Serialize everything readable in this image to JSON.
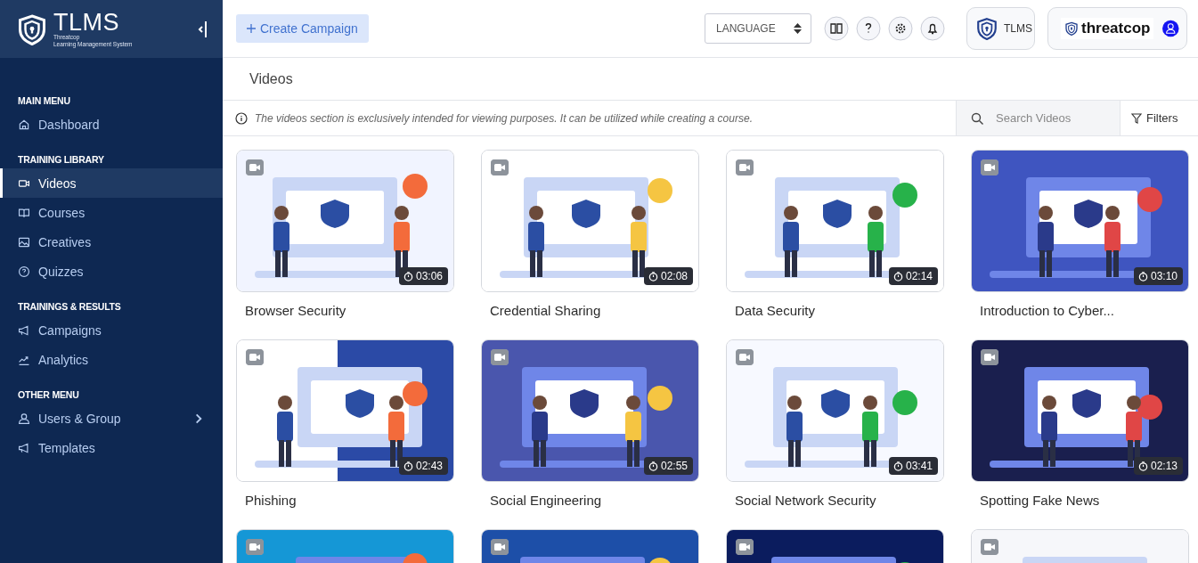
{
  "brand": {
    "name": "TLMS",
    "company": "Threatcop",
    "subtitle": "Learning Management System"
  },
  "sidebar": {
    "sections": [
      {
        "heading": "MAIN MENU",
        "items": [
          {
            "label": "Dashboard",
            "kind": "link",
            "selected": false
          }
        ]
      },
      {
        "heading": "TRAINING LIBRARY",
        "items": [
          {
            "label": "Videos",
            "kind": "link",
            "selected": true
          },
          {
            "label": "Courses",
            "kind": "link",
            "selected": false
          },
          {
            "label": "Creatives",
            "kind": "link",
            "selected": false
          },
          {
            "label": "Quizzes",
            "kind": "link",
            "selected": false
          }
        ]
      },
      {
        "heading": "TRAININGS & RESULTS",
        "items": [
          {
            "label": "Campaigns",
            "kind": "link",
            "selected": false
          },
          {
            "label": "Analytics",
            "kind": "link",
            "selected": false
          }
        ]
      },
      {
        "heading": "OTHER MENU",
        "items": [
          {
            "label": "Users & Group",
            "kind": "group",
            "selected": false
          },
          {
            "label": "Templates",
            "kind": "link",
            "selected": false
          }
        ]
      }
    ]
  },
  "header": {
    "create_button": "Create Campaign",
    "language": "LANGUAGE",
    "product_logo": "TLMS",
    "company_logo": "threatcop"
  },
  "page": {
    "title": "Videos",
    "notice": "The videos section is exclusively intended for viewing purposes. It can be utilized while creating a course.",
    "search": {
      "placeholder": "Search Videos"
    },
    "filters": "Filters"
  },
  "videos": [
    {
      "thumbnail": {
        "kind": "picture"
      },
      "duration": "03:06",
      "title": "Browser Security"
    },
    {
      "thumbnail": {
        "kind": "picture"
      },
      "duration": "02:08",
      "title": "Credential Sharing"
    },
    {
      "thumbnail": {
        "kind": "picture"
      },
      "duration": "02:14",
      "title": "Data Security"
    },
    {
      "thumbnail": {
        "kind": "picture"
      },
      "duration": "03:10",
      "title": "Introduction to Cyber..."
    },
    {
      "thumbnail": {
        "kind": "picture"
      },
      "duration": "02:43",
      "title": "Phishing"
    },
    {
      "thumbnail": {
        "kind": "picture"
      },
      "duration": "02:55",
      "title": "Social Engineering"
    },
    {
      "thumbnail": {
        "kind": "picture"
      },
      "duration": "03:41",
      "title": "Social Network Security"
    },
    {
      "thumbnail": {
        "kind": "picture"
      },
      "duration": "02:13",
      "title": "Spotting Fake News"
    },
    {
      "thumbnail": {
        "kind": "picture"
      }
    },
    {
      "thumbnail": {
        "kind": "picture"
      }
    },
    {
      "thumbnail": {
        "kind": "picture"
      }
    },
    {
      "thumbnail": {
        "kind": "picture"
      }
    }
  ]
}
